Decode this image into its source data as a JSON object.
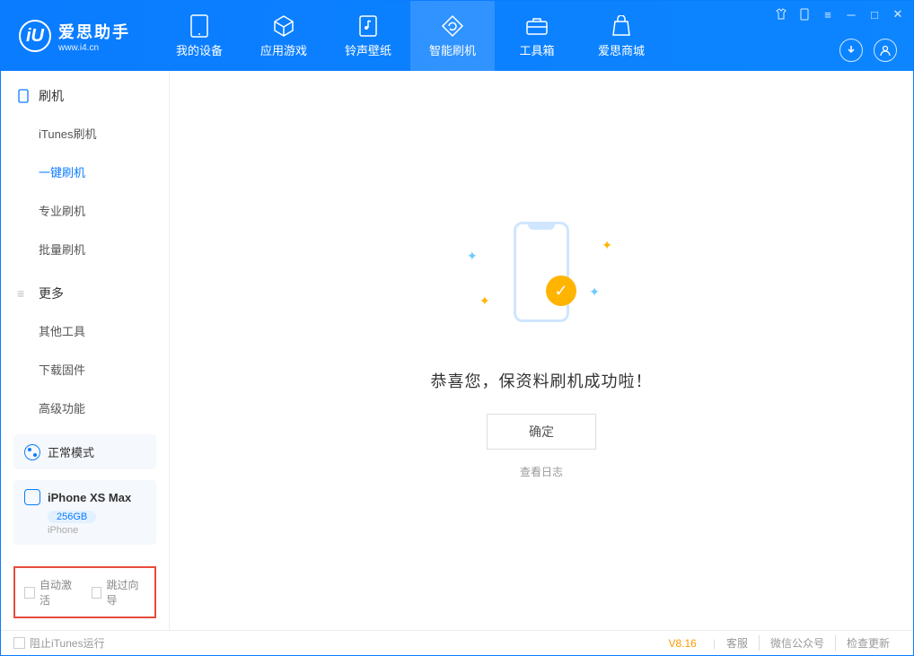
{
  "app": {
    "name": "爱思助手",
    "url": "www.i4.cn"
  },
  "nav": [
    {
      "label": "我的设备",
      "icon": "device"
    },
    {
      "label": "应用游戏",
      "icon": "cube"
    },
    {
      "label": "铃声壁纸",
      "icon": "music"
    },
    {
      "label": "智能刷机",
      "icon": "refresh",
      "active": true
    },
    {
      "label": "工具箱",
      "icon": "toolbox"
    },
    {
      "label": "爱思商城",
      "icon": "shop"
    }
  ],
  "sidebar": {
    "section1": {
      "title": "刷机",
      "items": [
        "iTunes刷机",
        "一键刷机",
        "专业刷机",
        "批量刷机"
      ],
      "activeIndex": 1
    },
    "section2": {
      "title": "更多",
      "items": [
        "其他工具",
        "下载固件",
        "高级功能"
      ]
    },
    "status": "正常模式",
    "device": {
      "name": "iPhone XS Max",
      "storage": "256GB",
      "type": "iPhone"
    },
    "checks": {
      "autoActivate": "自动激活",
      "skipGuide": "跳过向导"
    }
  },
  "main": {
    "successMsg": "恭喜您，保资料刷机成功啦！",
    "okBtn": "确定",
    "logLink": "查看日志"
  },
  "footer": {
    "blockItunes": "阻止iTunes运行",
    "version": "V8.16",
    "links": [
      "客服",
      "微信公众号",
      "检查更新"
    ]
  }
}
